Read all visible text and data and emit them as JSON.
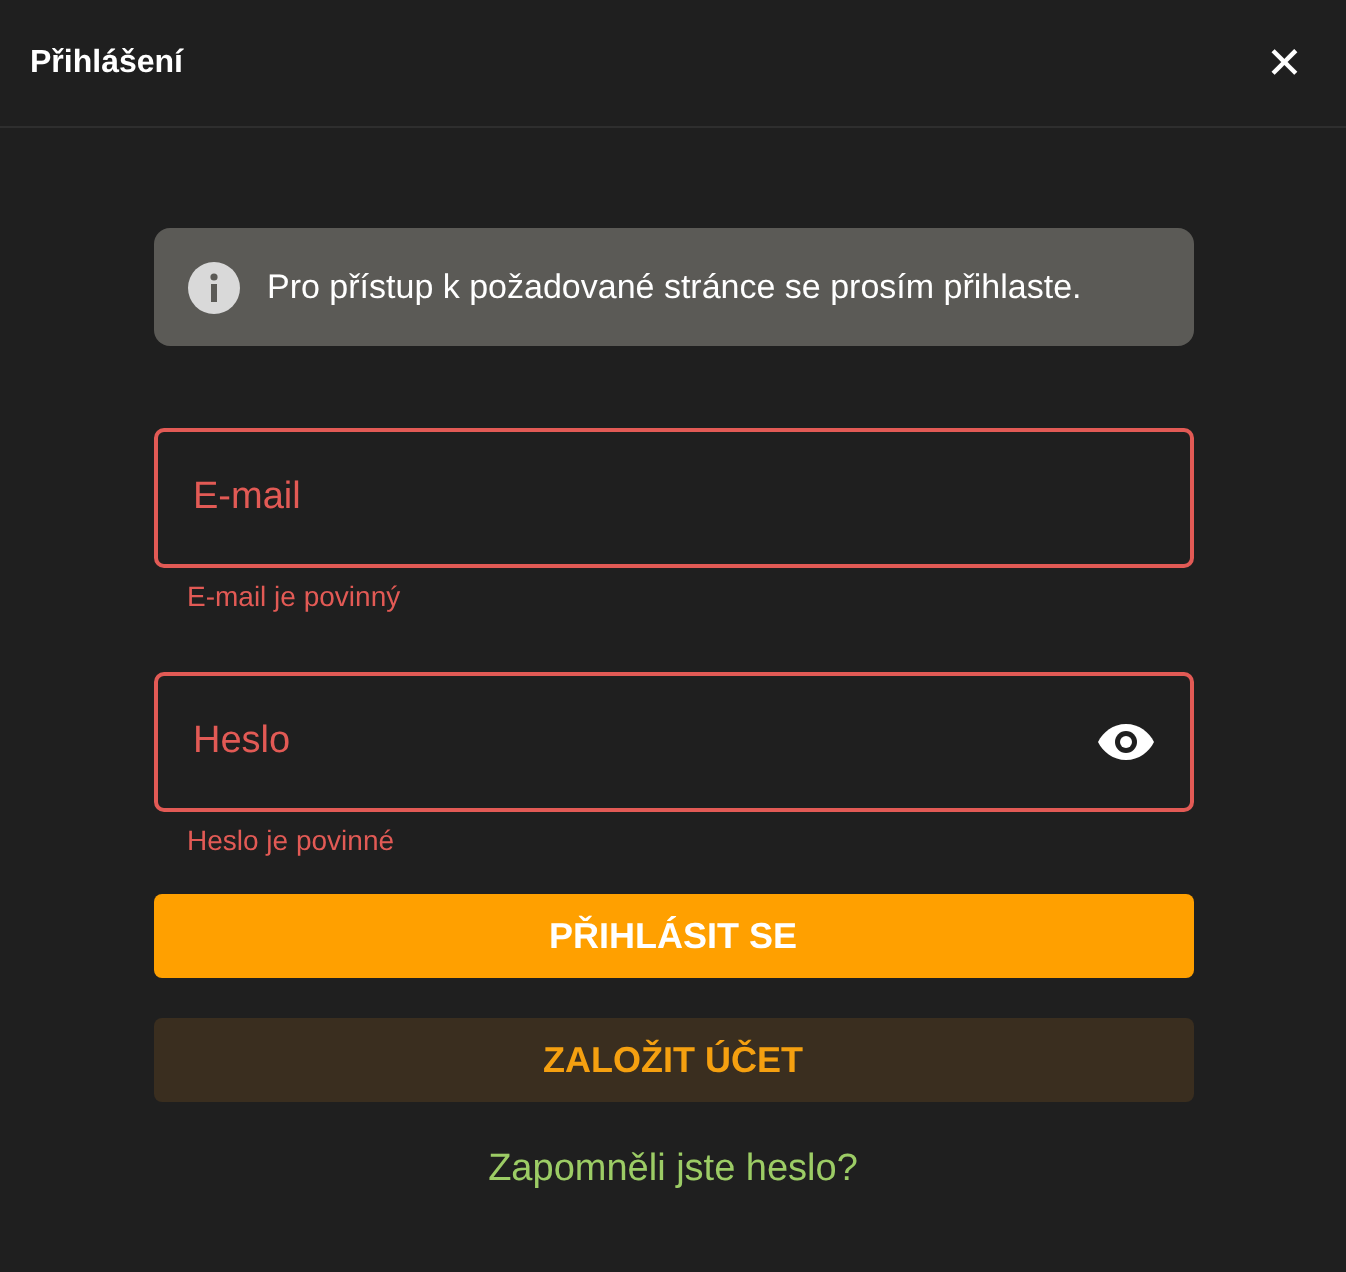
{
  "dialog": {
    "title": "Přihlášení",
    "close_symbol": "✕"
  },
  "notice": {
    "text": "Pro přístup k požadované stránce se prosím přihlaste."
  },
  "fields": [
    {
      "kind": "email",
      "placeholder": "E-mail",
      "invalid": true,
      "error": "E-mail je povinný"
    },
    {
      "kind": "password",
      "placeholder": "Heslo",
      "invalid": true,
      "error": "Heslo je povinné"
    }
  ],
  "buttons": [
    {
      "kind": "primary",
      "label": "PŘIHLÁSIT SE"
    },
    {
      "kind": "secondary",
      "label": "ZALOŽIT ÚČET"
    }
  ],
  "link": {
    "text": "Zapomněli jste heslo?"
  }
}
